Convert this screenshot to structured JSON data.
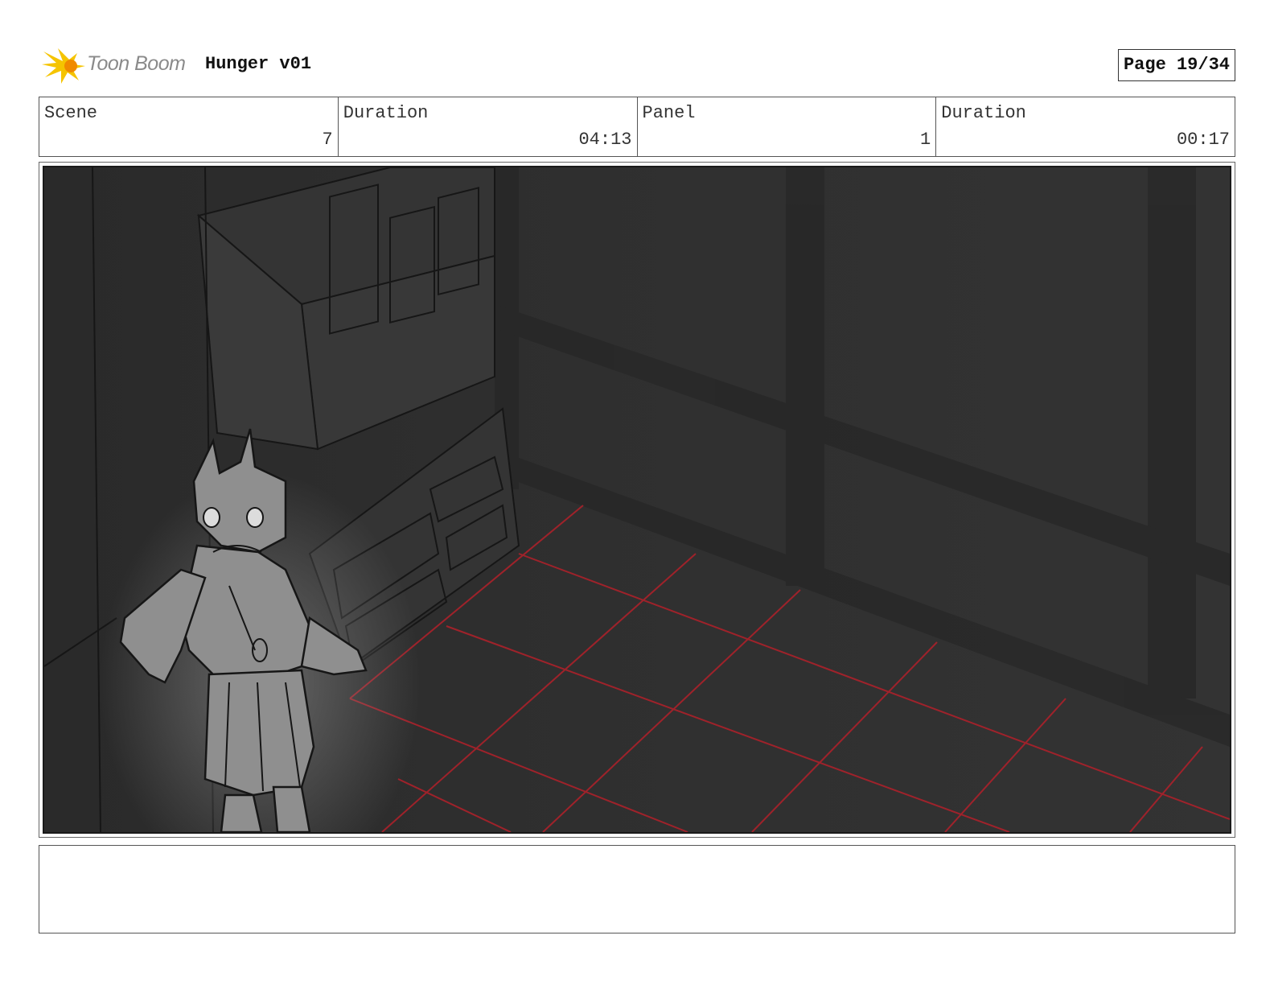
{
  "header": {
    "logo_text": "Toon Boom",
    "project_title": "Hunger v01",
    "page_label": "Page 19/34"
  },
  "info": [
    {
      "label": "Scene",
      "value": "7"
    },
    {
      "label": "Duration",
      "value": "04:13"
    },
    {
      "label": "Panel",
      "value": "1"
    },
    {
      "label": "Duration",
      "value": "00:17"
    }
  ],
  "colors": {
    "logo_yellow": "#f5c400",
    "logo_orange": "#f08a00",
    "sketch_background": "#2e2e2e",
    "floor_grid": "#b3202a"
  },
  "notes": ""
}
